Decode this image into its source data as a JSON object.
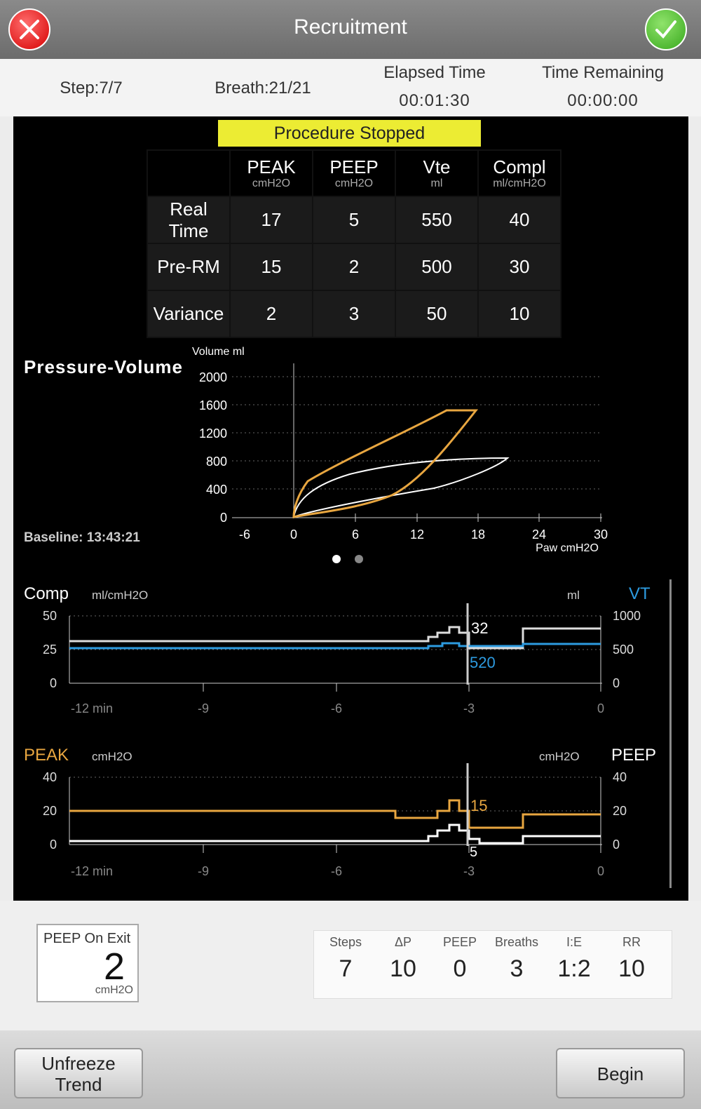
{
  "header": {
    "title": "Recruitment",
    "cancel_icon": "close-icon",
    "confirm_icon": "check-icon"
  },
  "status": {
    "step": "Step:7/7",
    "breath": "Breath:21/21",
    "elapsed_label": "Elapsed Time",
    "elapsed_value": "00:01:30",
    "remaining_label": "Time Remaining",
    "remaining_value": "00:00:00"
  },
  "banner": "Procedure Stopped",
  "table": {
    "headers": [
      {
        "name": "PEAK",
        "unit": "cmH2O"
      },
      {
        "name": "PEEP",
        "unit": "cmH2O"
      },
      {
        "name": "Vte",
        "unit": "ml"
      },
      {
        "name": "Compl",
        "unit": "ml/cmH2O"
      }
    ],
    "rows": [
      {
        "label": "Real Time",
        "values": [
          "17",
          "5",
          "550",
          "40"
        ]
      },
      {
        "label": "Pre-RM",
        "values": [
          "15",
          "2",
          "500",
          "30"
        ]
      },
      {
        "label": "Variance",
        "values": [
          "2",
          "3",
          "50",
          "10"
        ]
      }
    ]
  },
  "pv": {
    "title": "Pressure-Volume",
    "baseline": "Baseline: 13:43:21",
    "y_label": "Volume ml",
    "x_label": "Paw cmH2O",
    "y_ticks": [
      "2000",
      "1600",
      "1200",
      "800",
      "400",
      "0"
    ],
    "x_ticks": [
      "-6",
      "0",
      "6",
      "12",
      "18",
      "24",
      "30"
    ]
  },
  "comp_trend": {
    "left_label": "Comp",
    "left_unit": "ml/cmH2O",
    "right_unit": "ml",
    "right_label": "VT",
    "left_ticks": [
      "50",
      "25",
      "0"
    ],
    "right_ticks": [
      "1000",
      "500",
      "0"
    ],
    "x_ticks": [
      "-12 min",
      "-9",
      "-6",
      "-3",
      "0"
    ],
    "cursor_value_comp": "32",
    "cursor_value_vt": "520"
  },
  "peak_trend": {
    "left_label": "PEAK",
    "left_unit": "cmH2O",
    "right_unit": "cmH2O",
    "right_label": "PEEP",
    "left_ticks": [
      "40",
      "20",
      "0"
    ],
    "right_ticks": [
      "40",
      "20",
      "0"
    ],
    "x_ticks": [
      "-12 min",
      "-9",
      "-6",
      "-3",
      "0"
    ],
    "cursor_value_peak": "15",
    "cursor_value_peep": "5"
  },
  "peep_exit": {
    "label": "PEEP On Exit",
    "value": "2",
    "unit": "cmH2O"
  },
  "settings": [
    {
      "key": "Steps",
      "value": "7"
    },
    {
      "key": "ΔP",
      "value": "10"
    },
    {
      "key": "PEEP",
      "value": "0"
    },
    {
      "key": "Breaths",
      "value": "3"
    },
    {
      "key": "I:E",
      "value": "1:2"
    },
    {
      "key": "RR",
      "value": "10"
    }
  ],
  "buttons": {
    "unfreeze_line1": "Unfreeze",
    "unfreeze_line2": "Trend",
    "begin": "Begin"
  },
  "colors": {
    "peak": "#e8a640",
    "vt": "#2d9be0",
    "banner": "#ecec33"
  }
}
